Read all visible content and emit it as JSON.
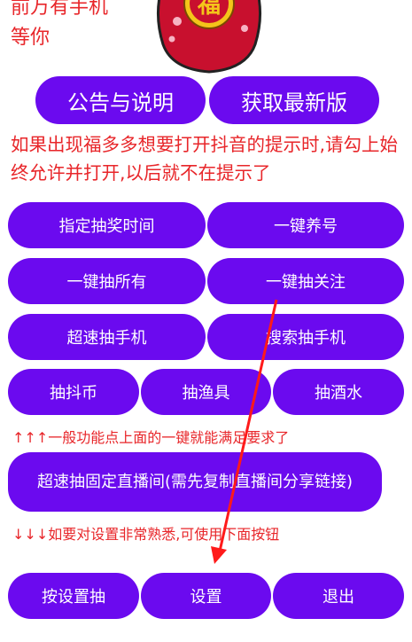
{
  "intro": {
    "line1": "前万有手机",
    "line2": "等你"
  },
  "bag": {
    "character": "福"
  },
  "top_buttons": {
    "announcement": "公告与说明",
    "latest_version": "获取最新版"
  },
  "notice": "如果出现福多多想要打开抖音的提示时,请勾上始终允许并打开,以后就不在提示了",
  "grid": {
    "schedule": "指定抽奖时间",
    "nurture": "一键养号",
    "draw_all": "一键抽所有",
    "draw_follow": "一键抽关注",
    "fast_phone": "超速抽手机",
    "search_phone": "搜索抽手机",
    "coins": "抽抖币",
    "fishing": "抽渔具",
    "liquor": "抽酒水"
  },
  "hint_up": "↑↑↑一般功能点上面的一键就能满足要求了",
  "fixed_live": "超速抽固定直播间(需先复制直播间分享链接)",
  "hint_down": "↓↓↓如要对设置非常熟悉,可使用下面按钮",
  "bottom": {
    "by_settings": "按设置抽",
    "settings": "设置",
    "exit": "退出"
  },
  "colors": {
    "button": "#6b0aef",
    "text_red": "#e8262a",
    "arrow": "#ff1a1a"
  }
}
